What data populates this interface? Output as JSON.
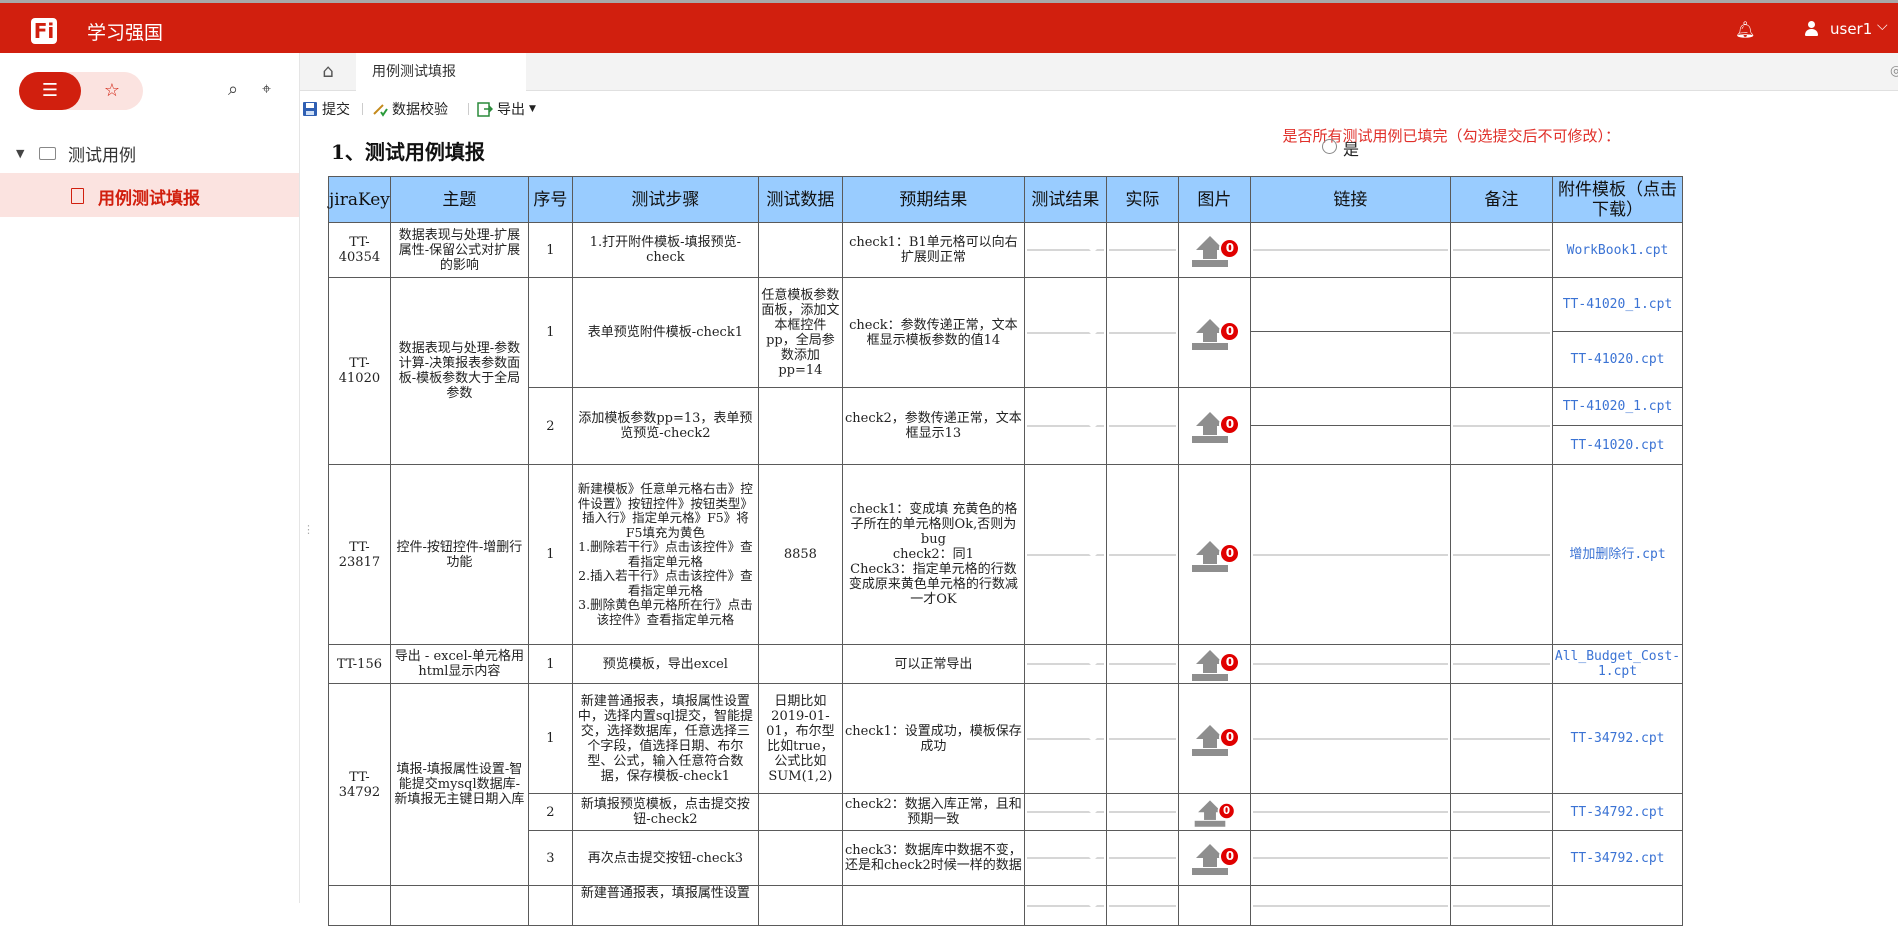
{
  "app": {
    "title": "学习强国",
    "logo_letter": "Fi",
    "user": "user1",
    "brand_color": "#d11f0e"
  },
  "sidebar": {
    "folder": "测试用例",
    "item": "用例测试填报"
  },
  "tabs": {
    "active": "用例测试填报"
  },
  "toolbar": {
    "submit": "提交",
    "validate": "数据校验",
    "export": "导出"
  },
  "content": {
    "section_title": "1、测试用例填报",
    "question": "是否所有测试用例已填完（勾选提交后不可修改）：",
    "radio_label": "是",
    "headers": [
      "jiraKey",
      "主题",
      "序号",
      "测试步骤",
      "测试数据",
      "预期结果",
      "测试结果",
      "实际",
      "图片",
      "链接",
      "备注",
      "附件模板（点击下载）"
    ],
    "badge": "0",
    "rows": [
      {
        "key": "TT-40354",
        "topic": "数据表现与处理-扩展属性-保留公式对扩展的影响",
        "seq": "1",
        "steps": "1.打开附件模板-填报预览-check",
        "data": "",
        "expected": "check1：B1单元格可以向右扩展则正常",
        "attach": [
          "WorkBook1.cpt"
        ]
      },
      {
        "key": "TT-41020",
        "topic": "数据表现与处理-参数计算-决策报表参数面板-模板参数大于全局参数",
        "seq": "1",
        "steps": "表单预览附件模板-check1",
        "data": "任意模板参数面板，添加文本框控件pp，全局参数添加pp=14",
        "expected": "check：参数传递正常，文本框显示模板参数的值14",
        "attach": [
          "TT-41020_1.cpt",
          "TT-41020.cpt"
        ]
      },
      {
        "seq": "2",
        "steps": "添加模板参数pp=13，表单预览预览-check2",
        "data": "",
        "expected": "check2，参数传递正常，文本框显示13",
        "attach": [
          "TT-41020_1.cpt",
          "TT-41020.cpt"
        ]
      },
      {
        "key": "TT-23817",
        "topic": "控件-按钮控件-增删行功能",
        "seq": "1",
        "steps": "新建模板》任意单元格右击》控件设置》按钮控件》按钮类型》插入行》指定单元格》F5》将F5填充为黄色\n1.删除若干行》点击该控件》查看指定单元格\n2.插入若干行》点击该控件》查看指定单元格\n3.删除黄色单元格所在行》点击该控件》查看指定单元格",
        "data": "8858",
        "expected": "check1：变成填 充黄色的格子所在的单元格则Ok,否则为bug\ncheck2：同1\nCheck3：指定单元格的行数变成原来黄色单元格的行数减一才OK",
        "attach": [
          "增加删除行.cpt"
        ]
      },
      {
        "key": "TT-156",
        "topic": "导出 - excel-单元格用html显示内容",
        "seq": "1",
        "steps": "预览模板，导出excel",
        "data": "",
        "expected": "可以正常导出",
        "attach": [
          "All_Budget_Cost-1.cpt"
        ]
      },
      {
        "key": "TT-34792",
        "topic": "填报-填报属性设置-智能提交mysql数据库-新填报无主键日期入库",
        "seq": "1",
        "steps": "新建普通报表，填报属性设置中，选择内置sql提交，智能提交，选择数据库，任意选择三个字段，值选择日期、布尔型、公式，输入任意符合数据，保存模板-check1",
        "data": "日期比如2019-01-01，布尔型比如true，公式比如SUM(1,2)",
        "expected": "check1：设置成功，模板保存成功",
        "attach": [
          "TT-34792.cpt"
        ]
      },
      {
        "seq": "2",
        "steps": "新填报预览模板，点击提交按钮-check2",
        "data": "",
        "expected": "check2：数据入库正常，且和预期一致",
        "attach": [
          "TT-34792.cpt"
        ]
      },
      {
        "seq": "3",
        "steps": "再次点击提交按钮-check3",
        "data": "",
        "expected": "check3：数据库中数据不变，还是和check2时候一样的数据",
        "attach": [
          "TT-34792.cpt"
        ]
      },
      {
        "steps": "新建普通报表，填报属性设置"
      }
    ]
  }
}
